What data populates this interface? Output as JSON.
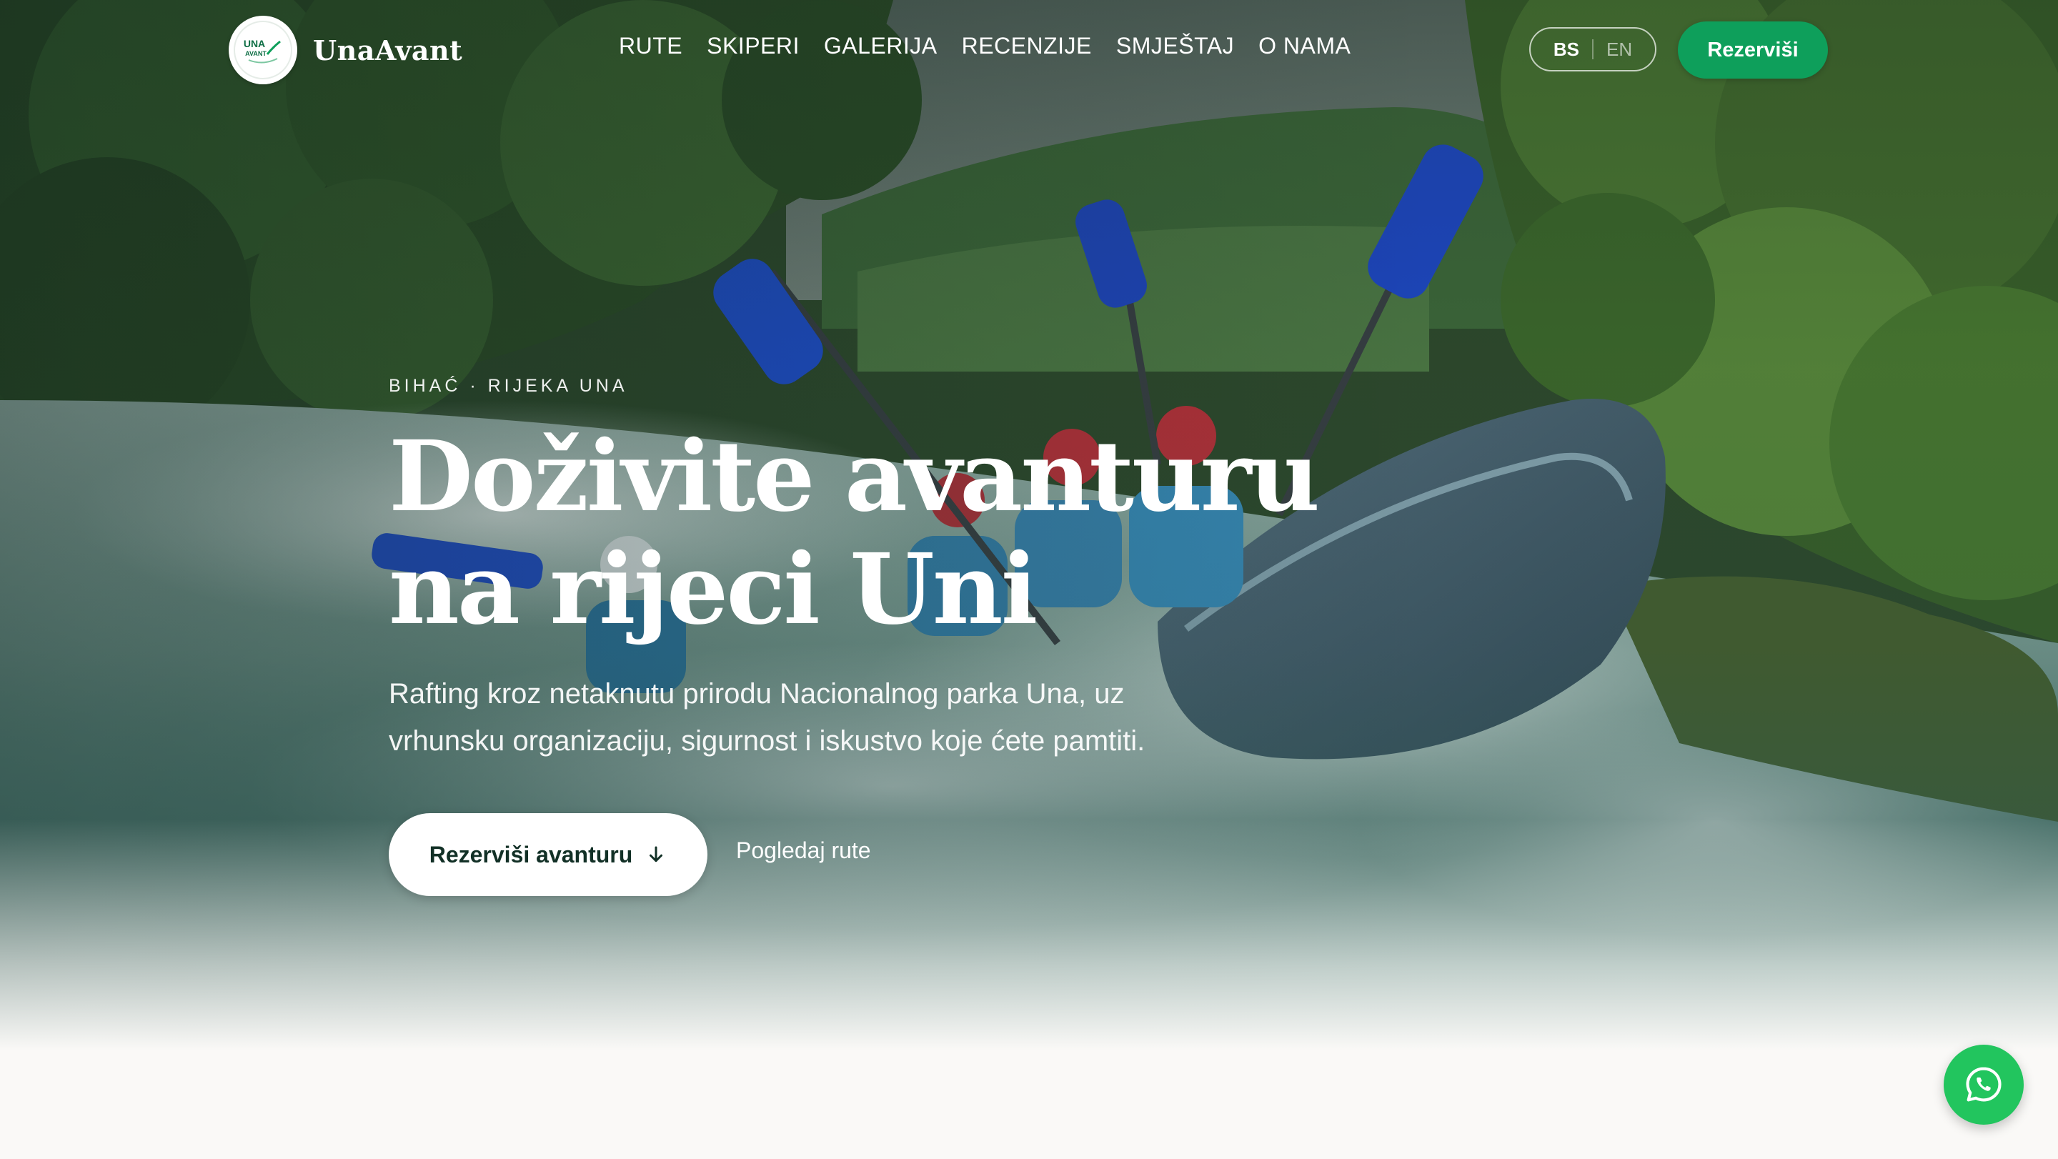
{
  "brand": {
    "name": "UnaAvant",
    "badge_line1": "UNA",
    "badge_line2": "AVANT"
  },
  "nav": {
    "links": [
      {
        "label": "RUTE"
      },
      {
        "label": "SKIPERI"
      },
      {
        "label": "GALERIJA"
      },
      {
        "label": "RECENZIJE"
      },
      {
        "label": "SMJEŠTAJ"
      },
      {
        "label": "O NAMA"
      }
    ],
    "languages": {
      "active": "BS",
      "inactive": "EN"
    },
    "reserve_label": "Rezerviši"
  },
  "hero": {
    "eyebrow": "BIHAĆ · RIJEKA UNA",
    "title_line1": "Doživite avanturu",
    "title_line2": "na rijeci Uni",
    "subtitle": "Rafting kroz netaknutu prirodu Nacionalnog parka Una, uz vrhunsku organizaciju, sigurnost i iskustvo koje ćete pamtiti.",
    "cta_primary": "Rezerviši avanturu",
    "cta_secondary": "Pogledaj rute"
  },
  "icons": {
    "logo": "una-avant-logo-icon",
    "cta_arrow": "arrow-down-icon",
    "whatsapp": "whatsapp-icon"
  },
  "colors": {
    "accent_green": "#0e9f5b",
    "whatsapp_green": "#22c55e",
    "dark_text": "#123026",
    "page_bg": "#faf9f7"
  }
}
